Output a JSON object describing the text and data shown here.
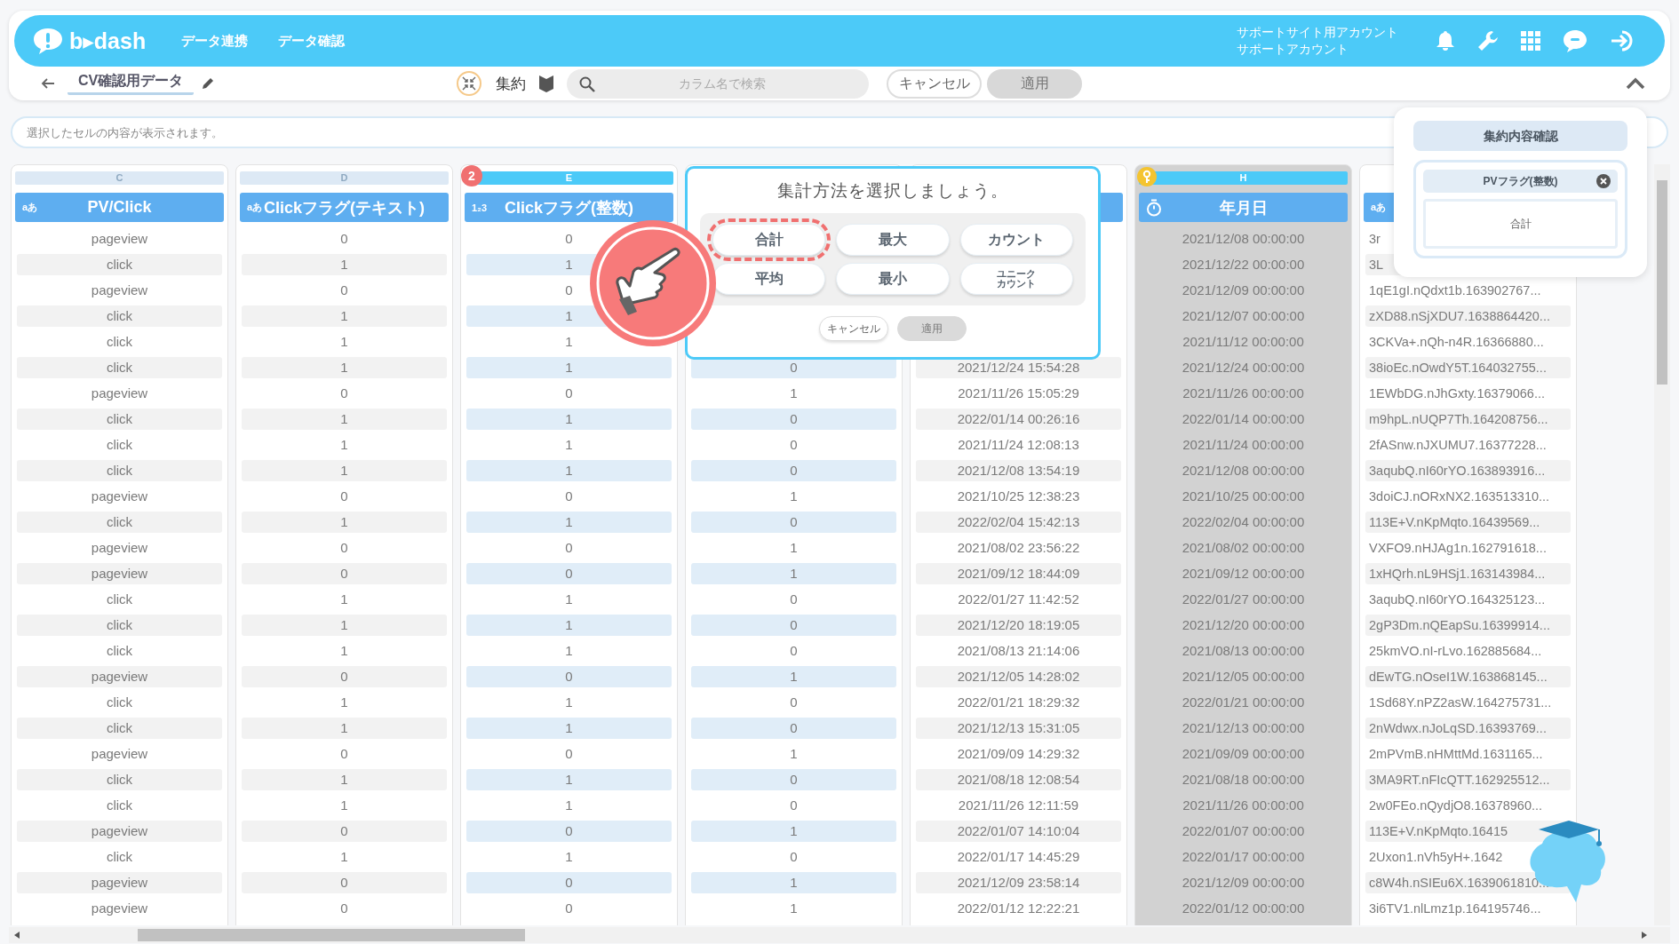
{
  "header": {
    "logo": "b▸dash",
    "nav": [
      {
        "label": "データ連携"
      },
      {
        "label": "データ確認"
      }
    ],
    "account": [
      "サポートサイト用アカウント",
      "サポートアカウント"
    ]
  },
  "toolbar": {
    "title": "CV確認用データ",
    "mode_label": "集約",
    "search": {
      "placeholder": "カラム名で検索"
    },
    "buttons": [
      {
        "label": "キャンセル",
        "disabled": false
      },
      {
        "label": "適用",
        "disabled": true
      }
    ]
  },
  "cell_viewer": {
    "placeholder": "選択したセルの内容が表示されます。"
  },
  "columns": [
    {
      "letter": "C",
      "letter_active": false,
      "label": "PV/Click",
      "kind": "text",
      "type_label": "aあ",
      "color": "#f2f2f2",
      "selected": false,
      "key": false,
      "cells": [
        "pageview",
        "click",
        "pageview",
        "click",
        "click",
        "click",
        "pageview",
        "click",
        "click",
        "click",
        "pageview",
        "click",
        "pageview",
        "pageview",
        "click",
        "click",
        "click",
        "pageview",
        "click",
        "click",
        "pageview",
        "click",
        "click",
        "pageview",
        "click",
        "pageview",
        "pageview"
      ]
    },
    {
      "letter": "D",
      "letter_active": false,
      "label": "Clickフラグ(テキスト)",
      "kind": "text",
      "type_label": "aあ",
      "color": "#f2f2f2",
      "selected": false,
      "key": false,
      "cells": [
        "0",
        "1",
        "0",
        "1",
        "1",
        "1",
        "0",
        "1",
        "1",
        "1",
        "0",
        "1",
        "0",
        "0",
        "1",
        "1",
        "1",
        "0",
        "1",
        "1",
        "0",
        "1",
        "1",
        "0",
        "1",
        "0",
        "0"
      ]
    },
    {
      "letter": "E",
      "letter_active": true,
      "badge": "2",
      "label": "Clickフラグ(整数)",
      "kind": "integer",
      "type_label": "1₂3",
      "color": "#e0edf8",
      "selected": false,
      "key": false,
      "cells": [
        "0",
        "1",
        "0",
        "1",
        "1",
        "1",
        "0",
        "1",
        "1",
        "1",
        "0",
        "1",
        "0",
        "0",
        "1",
        "1",
        "1",
        "0",
        "1",
        "1",
        "0",
        "1",
        "1",
        "0",
        "1",
        "0",
        "0"
      ]
    },
    {
      "color": "#e0edf8",
      "selected": false,
      "key": false,
      "cells": [
        null,
        null,
        null,
        null,
        null,
        "0",
        "1",
        "0",
        "0",
        "0",
        "1",
        "0",
        "1",
        "1",
        "0",
        "0",
        "0",
        "1",
        "0",
        "0",
        "1",
        "0",
        "0",
        "1",
        "0",
        "1",
        "1"
      ]
    },
    {
      "color": "#f2f2f2",
      "selected": false,
      "key": false,
      "cells": [
        null,
        null,
        null,
        null,
        null,
        "2021/12/24 15:54:28",
        "2021/11/26 15:05:29",
        "2022/01/14 00:26:16",
        "2021/11/24 12:08:13",
        "2021/12/08 13:54:19",
        "2021/10/25 12:38:23",
        "2022/02/04 15:42:13",
        "2021/08/02 23:56:22",
        "2021/09/12 18:44:09",
        "2022/01/27 11:42:52",
        "2021/12/20 18:19:05",
        "2021/08/13 21:14:06",
        "2021/12/05 14:28:02",
        "2022/01/21 18:29:32",
        "2021/12/13 15:31:05",
        "2021/09/09 14:29:32",
        "2021/08/18 12:08:54",
        "2021/11/26 12:11:59",
        "2022/01/07 14:10:04",
        "2022/01/17 14:45:29",
        "2021/12/09 23:58:14",
        "2022/01/12 12:22:21"
      ]
    },
    {
      "letter": "H",
      "letter_active": true,
      "label": "年月日",
      "kind": "date",
      "selected": true,
      "key": true,
      "cells": [
        "2021/12/08 00:00:00",
        "2021/12/22 00:00:00",
        "2021/12/09 00:00:00",
        "2021/12/07 00:00:00",
        "2021/11/12 00:00:00",
        "2021/12/24 00:00:00",
        "2021/11/26 00:00:00",
        "2022/01/14 00:00:00",
        "2021/11/24 00:00:00",
        "2021/12/08 00:00:00",
        "2021/10/25 00:00:00",
        "2022/02/04 00:00:00",
        "2021/08/02 00:00:00",
        "2021/09/12 00:00:00",
        "2022/01/27 00:00:00",
        "2021/12/20 00:00:00",
        "2021/08/13 00:00:00",
        "2021/12/05 00:00:00",
        "2022/01/21 00:00:00",
        "2021/12/13 00:00:00",
        "2021/09/09 00:00:00",
        "2021/08/18 00:00:00",
        "2021/11/26 00:00:00",
        "2022/01/07 00:00:00",
        "2022/01/17 00:00:00",
        "2021/12/09 00:00:00",
        "2022/01/12 00:00:00"
      ]
    },
    {
      "kind": "id",
      "type_label": "aあ",
      "color": "#f2f2f2",
      "selected": false,
      "key": false,
      "cells": [
        "3r",
        "3L",
        "1qE1gI.nQdxt1b.163902767...",
        "zXD88.nSjXDU7.1638864420...",
        "3CKVa+.nQh-n4R.16366880...",
        "38ioEc.nOwdY5T.164032755...",
        "1EWbDG.nJhGxty.16379066...",
        "m9hpL.nUQP7Th.164208756...",
        "2fASnw.nJXUMU7.16377228...",
        "3aqubQ.nI60rYO.163893916...",
        "3doiCJ.nORxNX2.163513310...",
        "113E+V.nKpMqto.16439569...",
        "VXFO9.nHJAg1n.162791618...",
        "1xHQrh.nL9HSj1.163143984...",
        "3aqubQ.nI60rYO.164325123...",
        "2gP3Dm.nQEapSu.16399914...",
        "25kmVO.nI-rLvo.162885684...",
        "dEwTG.nOseI1W.163868145...",
        "1Sd68Y.nPZ2asW.164275731...",
        "2nWdwx.nJoLqSD.16393769...",
        "2mPVmB.nHMttMd.1631165...",
        "3MA9RT.nFIcQTT.162925512...",
        "2w0FEo.nQydjO8.16378960...",
        "113E+V.nKpMqto.16415",
        "2Uxon1.nVh5yH+.1642",
        "c8W4h.nSIEu6X.1639061810...",
        "3i6TV1.nlLmz1p.164195746..."
      ]
    }
  ],
  "popup": {
    "title": "集計方法を選択しましょう。",
    "options": [
      {
        "label": "合計",
        "selected": true
      },
      {
        "label": "最大",
        "selected": false
      },
      {
        "label": "カウント",
        "selected": false
      },
      {
        "label": "平均",
        "selected": false
      },
      {
        "label": "最小",
        "selected": false
      },
      {
        "label": "ユニークカウント",
        "selected": false
      }
    ],
    "buttons": [
      {
        "label": "キャンセル",
        "disabled": false
      },
      {
        "label": "適用",
        "disabled": true
      }
    ]
  },
  "summary_panel": {
    "title": "集約内容確認",
    "chip": "PVフラグ(整数)",
    "method": "合計"
  }
}
